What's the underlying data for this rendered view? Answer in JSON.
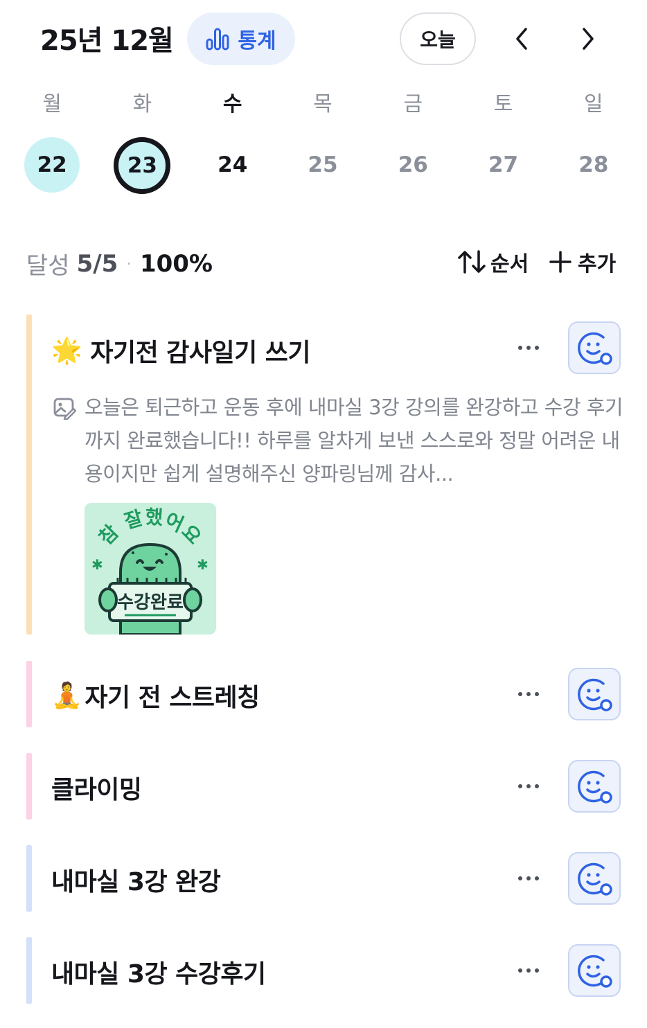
{
  "header": {
    "month_title": "25년 12월",
    "stats_label": "통계",
    "today_label": "오늘"
  },
  "week": {
    "days": [
      {
        "dow": "월",
        "date": "22",
        "state": "done"
      },
      {
        "dow": "화",
        "date": "23",
        "state": "selected"
      },
      {
        "dow": "수",
        "date": "24",
        "state": "today"
      },
      {
        "dow": "목",
        "date": "25",
        "state": "future"
      },
      {
        "dow": "금",
        "date": "26",
        "state": "future"
      },
      {
        "dow": "토",
        "date": "27",
        "state": "future"
      },
      {
        "dow": "일",
        "date": "28",
        "state": "future"
      }
    ]
  },
  "progress": {
    "label": "달성",
    "count": "5/5",
    "percent": "100%",
    "order_label": "순서",
    "add_label": "추가"
  },
  "habits": [
    {
      "emoji": "🌟",
      "title": "자기전 감사일기 쓰기",
      "bar_color": "#fbe0b6",
      "note": "오늘은 퇴근하고 운동 후에 내마실 3강 강의를 완강하고 수강 후기까지 완료했습니다!! 하루를 알차게 보낸 스스로와 정말 어려운 내용이지만 쉽게 설명해주신 양파링님께 감사...",
      "sticker": {
        "top_text": "참 잘했어요",
        "sign_text": "수강완료"
      }
    },
    {
      "emoji": "🧘",
      "title": "자기 전 스트레칭",
      "bar_color": "#fbd2e6"
    },
    {
      "emoji": "",
      "title": "클라이밍",
      "bar_color": "#fbd2e6"
    },
    {
      "emoji": "",
      "title": "내마실 3강 완강",
      "bar_color": "#d3e0fa"
    },
    {
      "emoji": "",
      "title": "내마실 3강 수강후기",
      "bar_color": "#d3e0fa"
    }
  ],
  "colors": {
    "accent": "#2f63e3",
    "done_circle": "#c9f2f5",
    "mood_icon": "#2f63e3"
  },
  "icons": {
    "stats": "bar-chart-icon",
    "prev": "chevron-left-icon",
    "next": "chevron-right-icon",
    "order": "sort-arrows-icon",
    "add": "plus-icon",
    "more": "more-dots-icon",
    "mood": "smiley-add-icon",
    "note": "photo-note-icon"
  }
}
